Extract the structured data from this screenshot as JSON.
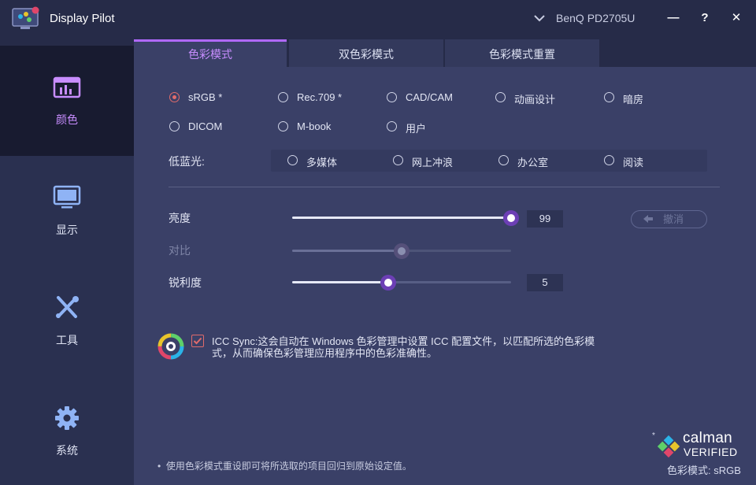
{
  "app": {
    "title": "Display Pilot",
    "monitor": "BenQ PD2705U"
  },
  "window_buttons": {
    "minimize": "—",
    "help": "?",
    "close": "✕"
  },
  "sidebar": {
    "items": [
      {
        "label": "颜色",
        "icon": "chart-icon",
        "active": true
      },
      {
        "label": "显示",
        "icon": "monitor-icon",
        "active": false
      },
      {
        "label": "工具",
        "icon": "tools-icon",
        "active": false
      },
      {
        "label": "系统",
        "icon": "gear-icon",
        "active": false
      }
    ]
  },
  "tabs": [
    {
      "label": "色彩模式",
      "active": true
    },
    {
      "label": "双色彩模式",
      "active": false
    },
    {
      "label": "色彩模式重置",
      "active": false
    }
  ],
  "color_modes": [
    {
      "label": "sRGB *",
      "checked": true
    },
    {
      "label": "Rec.709 *",
      "checked": false
    },
    {
      "label": "CAD/CAM",
      "checked": false
    },
    {
      "label": "动画设计",
      "checked": false
    },
    {
      "label": "暗房",
      "checked": false
    },
    {
      "label": "DICOM",
      "checked": false
    },
    {
      "label": "M-book",
      "checked": false
    },
    {
      "label": "用户",
      "checked": false
    }
  ],
  "low_blue_light": {
    "label": "低蓝光:",
    "options": [
      "多媒体",
      "网上冲浪",
      "办公室",
      "阅读"
    ]
  },
  "adjustments": {
    "brightness": {
      "label": "亮度",
      "value": "99",
      "fraction": 1.0,
      "disabled": false
    },
    "contrast": {
      "label": "对比",
      "fraction": 0.5,
      "disabled": true
    },
    "sharpness": {
      "label": "锐利度",
      "value": "5",
      "fraction": 0.44,
      "disabled": false
    },
    "undo_label": "撤消"
  },
  "icc_sync": {
    "checked": true,
    "text": "ICC Sync:这会自动在 Windows 色彩管理中设置 ICC 配置文件，以匹配所选的色彩模式，从而确保色彩管理应用程序中的色彩准确性。"
  },
  "footnote": "使用色彩模式重设即可将所选取的项目回归到原始设定值。",
  "calman": {
    "star": "*",
    "name": "calman",
    "verified": "VERIFIED"
  },
  "status": {
    "mode_label": "色彩模式: sRGB"
  },
  "colors": {
    "accent": "#b069ff",
    "selection": "#e06b6b",
    "panel": "#3a4067",
    "sidebar_active": "#181b30"
  }
}
